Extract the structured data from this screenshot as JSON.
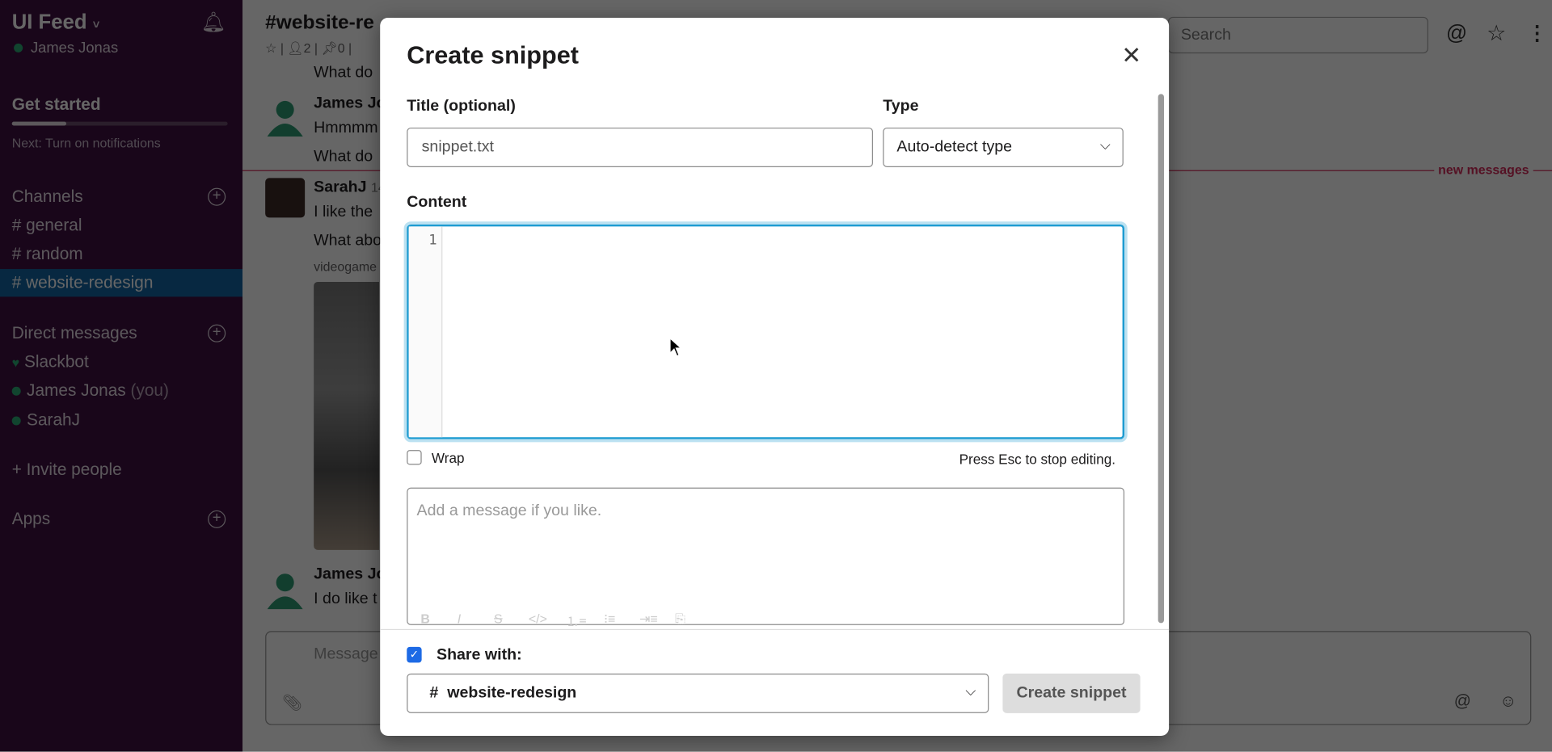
{
  "sidebar": {
    "workspace": "UI Feed",
    "user": "James Jonas",
    "get_started": "Get started",
    "progress": 0.25,
    "next_step": "Next: Turn on notifications",
    "channels_label": "Channels",
    "channels": [
      "general",
      "random",
      "website-redesign"
    ],
    "active_channel": "website-redesign",
    "dm_label": "Direct messages",
    "dms": [
      {
        "name": "Slackbot",
        "suffix": ""
      },
      {
        "name": "James Jonas",
        "suffix": "(you)"
      },
      {
        "name": "SarahJ",
        "suffix": ""
      }
    ],
    "invite": "Invite people",
    "apps_label": "Apps",
    "accent": "#3f0e40",
    "active_color": "#1164a3"
  },
  "header": {
    "channel": "#website-re",
    "members": "2",
    "pins": "0",
    "search_placeholder": "Search"
  },
  "messages": {
    "m0": "What do",
    "m1_name": "James Jo",
    "m1_text1": "Hmmmm",
    "m1_text2": "What do",
    "new_messages": "new messages",
    "m2_name": "SarahJ",
    "m2_time": "14",
    "m2_text1": "I like the",
    "m2_text2": "What abo",
    "m2_link": "videogame",
    "m3_name": "James Jo",
    "m3_text": "I do like t",
    "composer_placeholder": "Message"
  },
  "modal": {
    "title": "Create snippet",
    "title_label": "Title (optional)",
    "title_value": "snippet.txt",
    "type_label": "Type",
    "type_value": "Auto-detect type",
    "content_label": "Content",
    "line_number": "1",
    "wrap_label": "Wrap",
    "wrap_checked": false,
    "esc_hint": "Press Esc to stop editing.",
    "message_placeholder": "Add a message if you like.",
    "share_label": "Share with:",
    "share_checked": true,
    "share_channel": "website-redesign",
    "submit": "Create snippet"
  }
}
